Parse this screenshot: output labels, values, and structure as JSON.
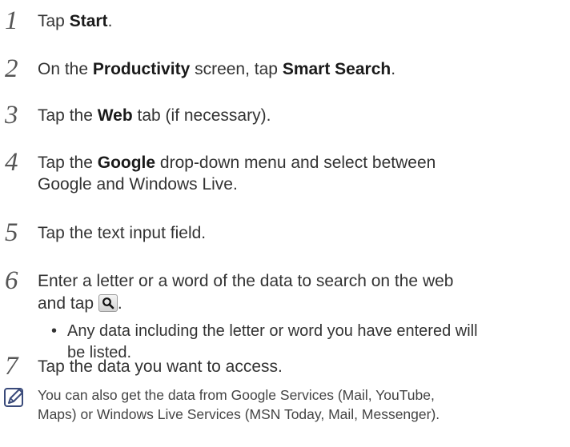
{
  "steps": [
    {
      "num": "1",
      "parts": [
        "Tap ",
        "Start",
        "."
      ]
    },
    {
      "num": "2",
      "parts": [
        "On the ",
        "Productivity",
        " screen, tap ",
        "Smart Search",
        "."
      ]
    },
    {
      "num": "3",
      "parts": [
        "Tap the ",
        "Web",
        " tab (if necessary)."
      ]
    },
    {
      "num": "4",
      "line1": [
        "Tap the ",
        "Google",
        " drop-down menu and select between"
      ],
      "line2": "Google and Windows Live."
    },
    {
      "num": "5",
      "text": "Tap the text input field."
    },
    {
      "num": "6",
      "line1": "Enter a letter or a word of the data to search on the web",
      "line2_pre": "and tap ",
      "line2_post": ".",
      "icon": "search-icon"
    },
    {
      "num": "7",
      "text": "Tap the data you want to access."
    }
  ],
  "bullet": {
    "symbol": "•",
    "line1": "Any data including the letter or word you have entered will",
    "line2": "be listed."
  },
  "note": {
    "icon": "note-icon",
    "line1": "You can also get the data from Google Services (Mail, YouTube,",
    "line2": "Maps) or Windows Live Services (MSN Today, Mail, Messenger)."
  }
}
